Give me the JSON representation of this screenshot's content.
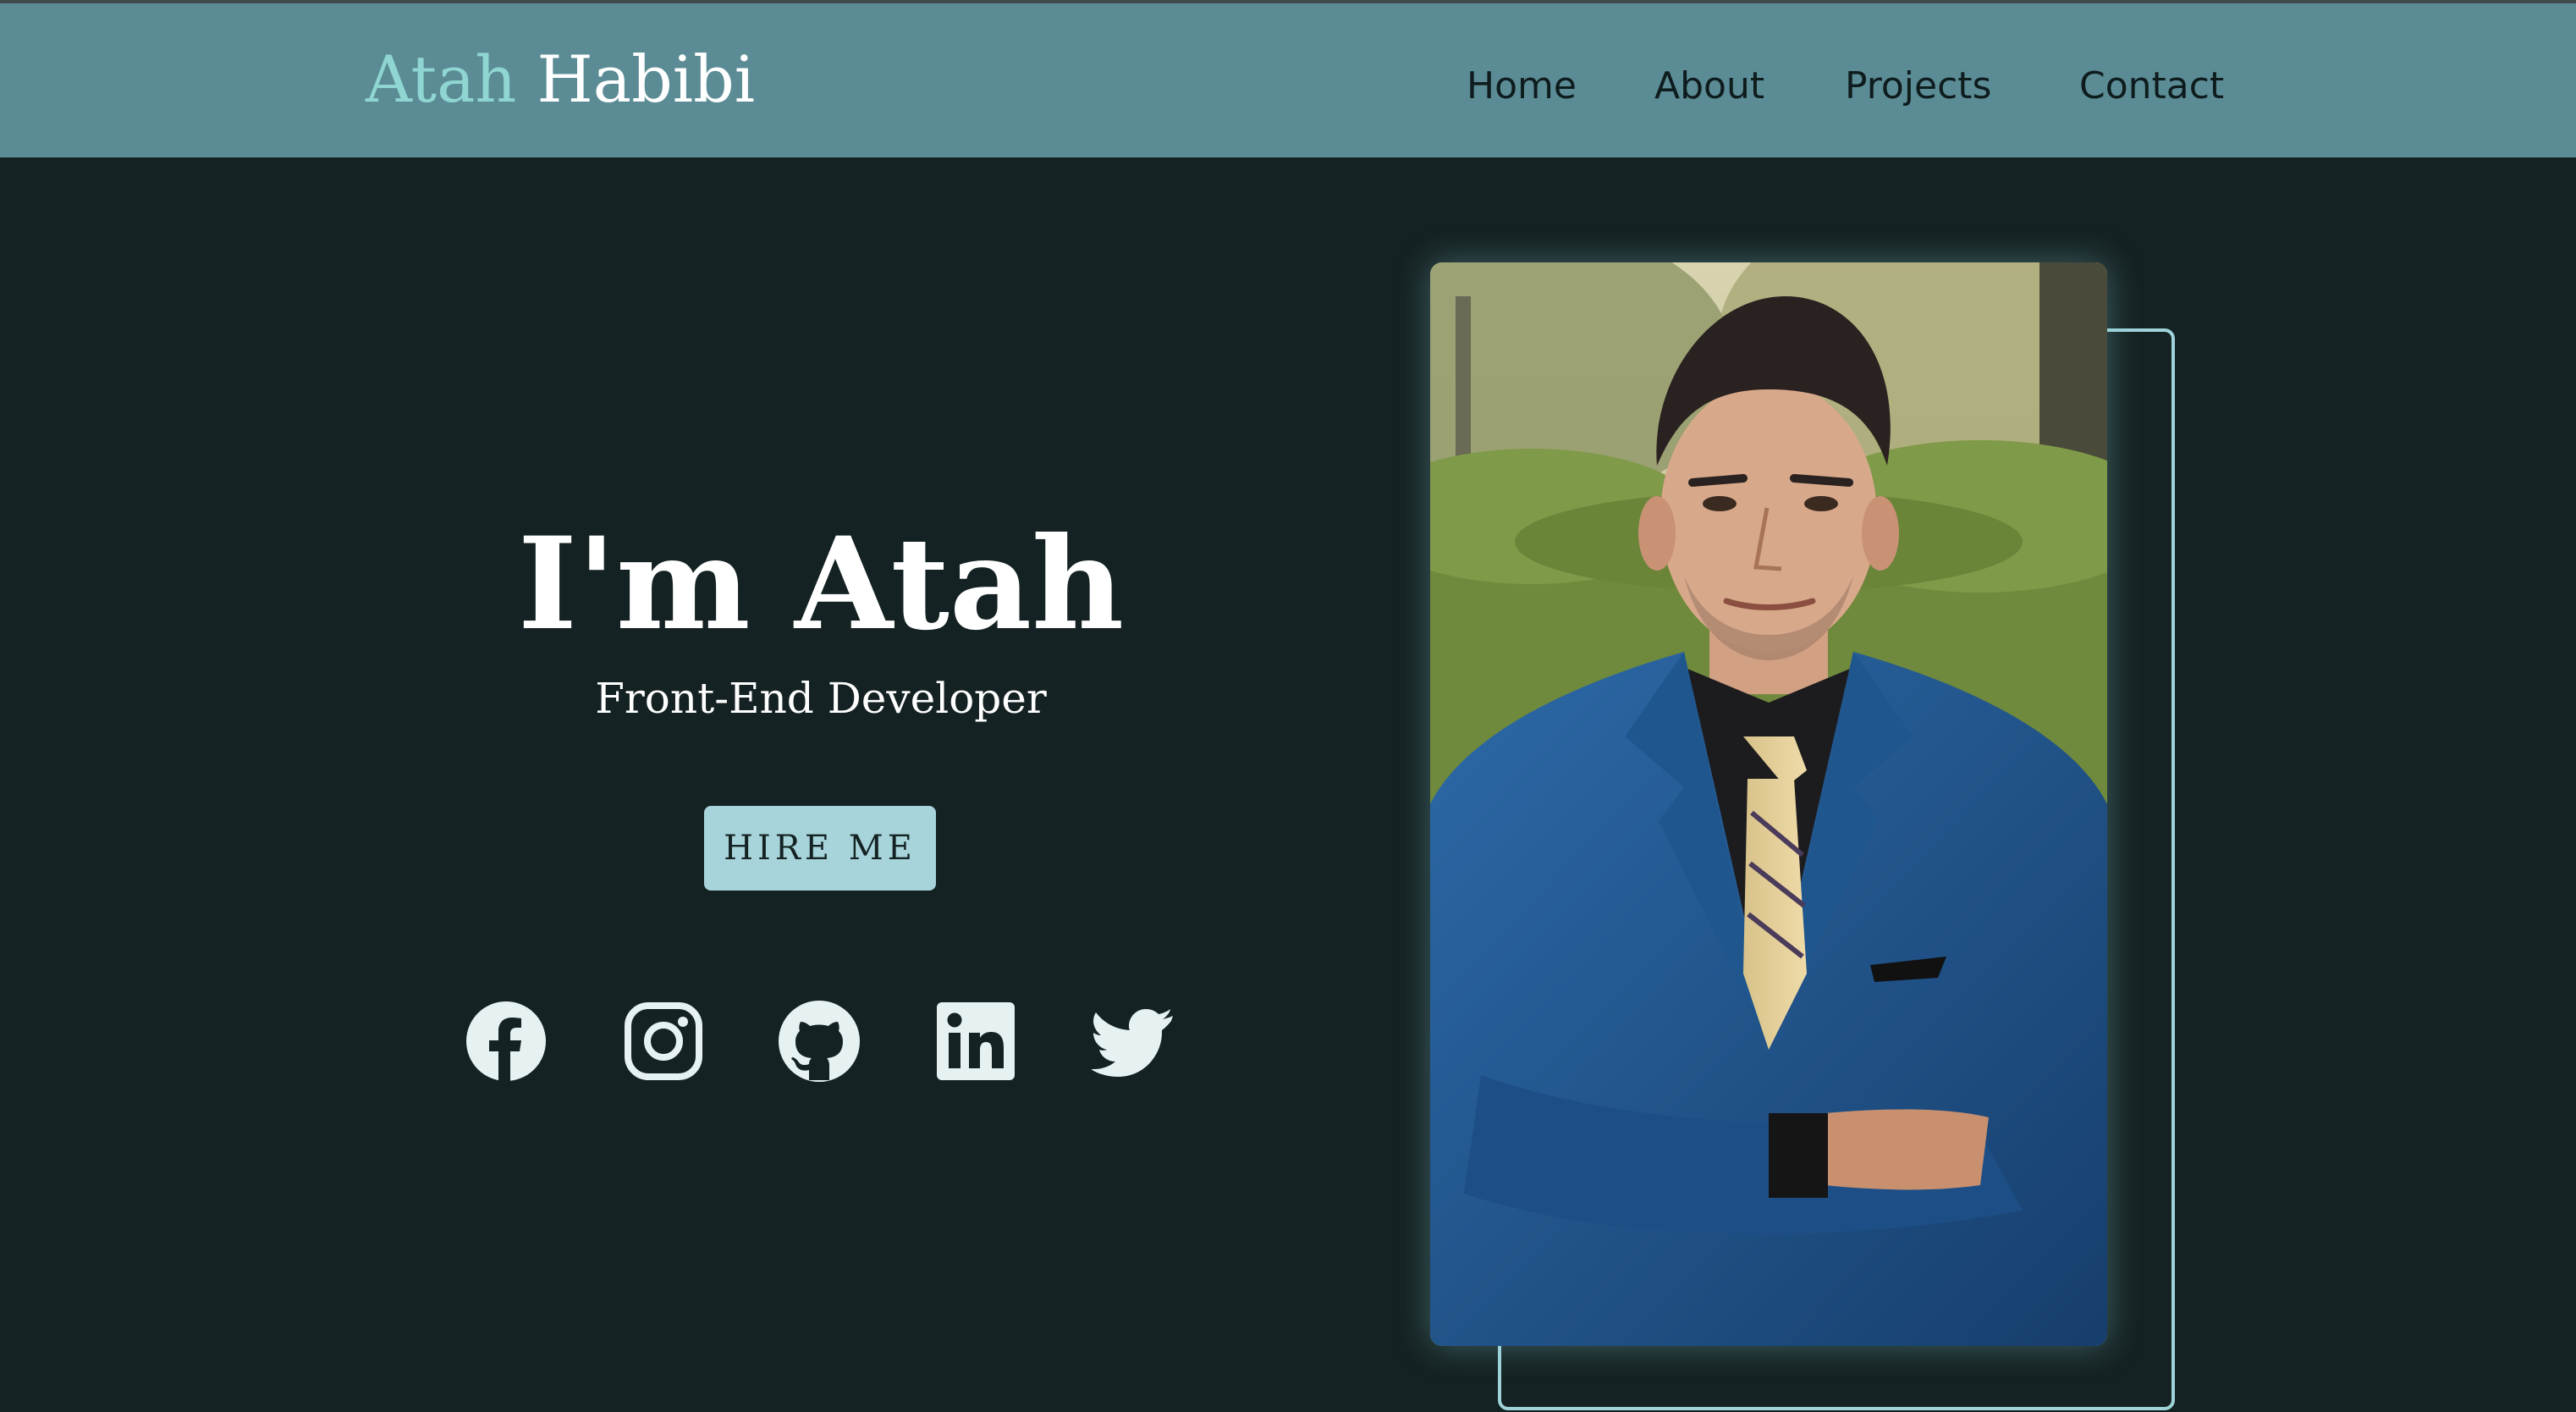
{
  "header": {
    "brand_first": "Atah",
    "brand_last": "Habibi",
    "nav": {
      "home": "Home",
      "about": "About",
      "projects": "Projects",
      "contact": "Contact"
    }
  },
  "hero": {
    "title": "I'm Atah",
    "subtitle": "Front-End Developer",
    "cta_label": "HIRE ME"
  },
  "social_icons": [
    "facebook-icon",
    "instagram-icon",
    "github-icon",
    "linkedin-icon",
    "twitter-icon"
  ],
  "colors": {
    "background": "#152223",
    "navbar": "#5b8c95",
    "brand_accent": "#8fd6d3",
    "button": "#a6d4da",
    "frame_border": "#9ed3da"
  }
}
